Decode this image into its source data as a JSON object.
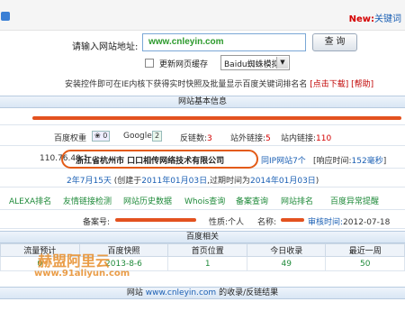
{
  "header": {
    "new_label": "New:",
    "new_link": "关键词"
  },
  "search": {
    "label": "请输入网站地址:",
    "value": "www.cnleyin.com",
    "button": "查 询",
    "update_cache_label": "更新网页缓存",
    "engine_select": "Baidu蜘蛛模拟",
    "tip": "安装控件即可在IE内核下获得实时快照及批量显示百度关键词排名名",
    "tip_link": "[点击下载]",
    "tip_link2": "[帮助]"
  },
  "basic_info": {
    "title": "网站基本信息",
    "baidu_weight_label": "百度权重",
    "baidu_weight_value": "0",
    "google_label": "Google",
    "google_value": "2",
    "backlinks_label": "反链数:",
    "backlinks_value": "3",
    "external_label": "站外链接:",
    "external_value": "5",
    "internal_label": "站内链接:",
    "internal_value": "110",
    "ip": "110.76.40.1",
    "location": "浙江省杭州市 口口相传网络技术有限公司",
    "same_ip_label": "同IP网站7个",
    "response_label": "[响应时间:",
    "response_value": "152毫秒",
    "response_close": "]",
    "age": "2年7月15天",
    "age_detail_prefix": "(创建于",
    "created": "2011年01月03日",
    "age_detail_mid": ",过期时间为",
    "expires": "2014年01月03日",
    "age_detail_suffix": ")",
    "links": [
      "ALEXA排名",
      "友情链接检测",
      "网站历史数据",
      "Whois查询",
      "备案查询",
      "网站排名",
      "百度异常提醒"
    ],
    "icp_label": "备案号:",
    "nature_label": "性质:",
    "nature_value": "个人",
    "name_label": "名称:",
    "audit_label": "审核时间:",
    "audit_value": "2012-07-18"
  },
  "baidu": {
    "title": "百度相关",
    "headers": [
      "流量预计",
      "百度快照",
      "首页位置",
      "今日收录",
      "最近一周"
    ],
    "values": [
      "0",
      "2013-8-6",
      "1",
      "49",
      "50"
    ]
  },
  "results": {
    "prefix": "网站",
    "site": "www.cnleyin.com",
    "suffix": "的收录/反链结果"
  },
  "watermark": {
    "line1": "赫盟阿里云",
    "line2": "www.91aliyun.com"
  },
  "colors": {
    "accent_red": "#d40000",
    "link_blue": "#1a5fb4",
    "section_bg": "#d9e6f4",
    "scribble_orange": "#e3521f"
  }
}
